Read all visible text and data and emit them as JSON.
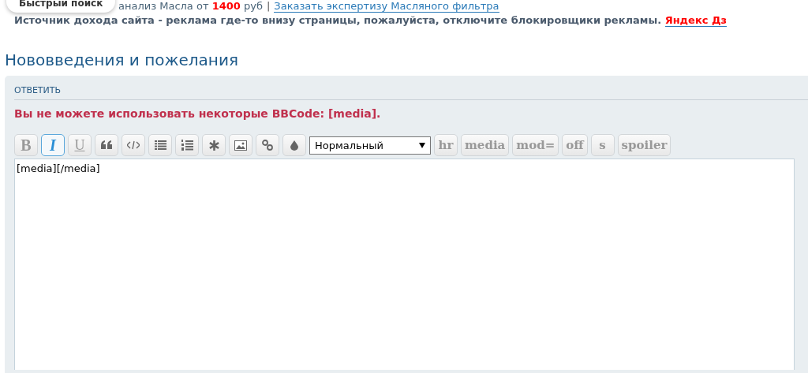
{
  "quick_search": {
    "label": "Быстрый поиск"
  },
  "promo": [
    {
      "kind": "plain",
      "text": "анализ Масла от "
    },
    {
      "kind": "price",
      "text": "1400"
    },
    {
      "kind": "plain",
      "text": " руб"
    },
    {
      "kind": "separator",
      "text": "|"
    },
    {
      "kind": "link",
      "text": "Заказать экспертизу Масляного фильтра"
    }
  ],
  "notice": {
    "text": "Источник дохода сайта - реклама где-то внизу страницы, пожалуйста, отключите блокировщики рекламы.",
    "link": "Яндекс Дз"
  },
  "page_title": "Нововведения и пожелания",
  "reply_tab": "ОТВЕТИТЬ",
  "warning": "Вы не можете использовать некоторые BBCode: [media].",
  "toolbar": [
    {
      "kind": "bold",
      "label": "B",
      "active": false
    },
    {
      "kind": "italic",
      "label": "I",
      "active": true
    },
    {
      "kind": "underline",
      "label": "U",
      "active": false
    },
    {
      "kind": "icon",
      "active": false
    },
    {
      "kind": "icon",
      "active": false
    },
    {
      "kind": "icon",
      "active": false
    },
    {
      "kind": "icon",
      "active": false
    },
    {
      "kind": "icon",
      "active": false
    },
    {
      "kind": "icon",
      "active": false
    },
    {
      "kind": "icon",
      "active": false
    },
    {
      "kind": "icon",
      "active": false
    },
    {
      "kind": "select",
      "value": "Нормальный"
    },
    {
      "kind": "tag",
      "label": "hr",
      "active": false
    },
    {
      "kind": "tag",
      "label": "media",
      "active": false
    },
    {
      "kind": "tag",
      "label": "mod=",
      "active": false
    },
    {
      "kind": "tag",
      "label": "off",
      "active": false
    },
    {
      "kind": "tag",
      "label": "s",
      "active": false
    },
    {
      "kind": "tag",
      "label": "spoiler",
      "active": false
    }
  ],
  "editor": {
    "value": "[media][/media]"
  }
}
